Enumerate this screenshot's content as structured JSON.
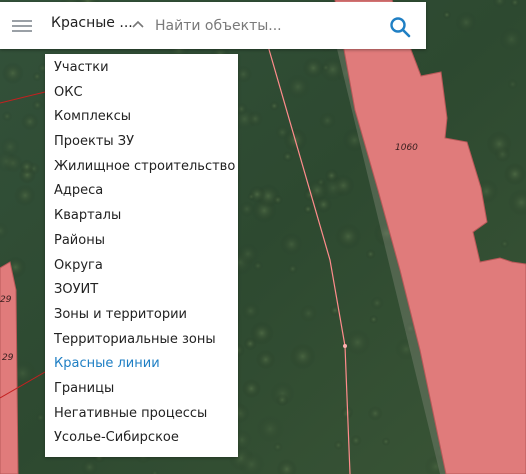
{
  "search": {
    "layer_label": "Красные ...",
    "placeholder": "Найти объекты..."
  },
  "layers": {
    "items": [
      {
        "label": "Участки"
      },
      {
        "label": "ОКС"
      },
      {
        "label": "Комплексы"
      },
      {
        "label": "Проекты ЗУ"
      },
      {
        "label": "Жилищное строительство"
      },
      {
        "label": "Адреса"
      },
      {
        "label": "Кварталы"
      },
      {
        "label": "Районы"
      },
      {
        "label": "Округа"
      },
      {
        "label": "ЗОУИТ"
      },
      {
        "label": "Зоны и территории"
      },
      {
        "label": "Территориальные зоны"
      },
      {
        "label": "Красные линии"
      },
      {
        "label": "Границы"
      },
      {
        "label": "Негативные процессы"
      },
      {
        "label": "Усолье-Сибирское"
      }
    ],
    "selected": "Красные линии"
  },
  "map": {
    "parcel_right_label": "1060",
    "parcel_left_label_top": "29",
    "parcel_left_label_bottom": "29"
  },
  "colors": {
    "parcel_fill": "#e07b7b",
    "forest": "#2f4a2c",
    "accent": "#1f7fc4"
  }
}
